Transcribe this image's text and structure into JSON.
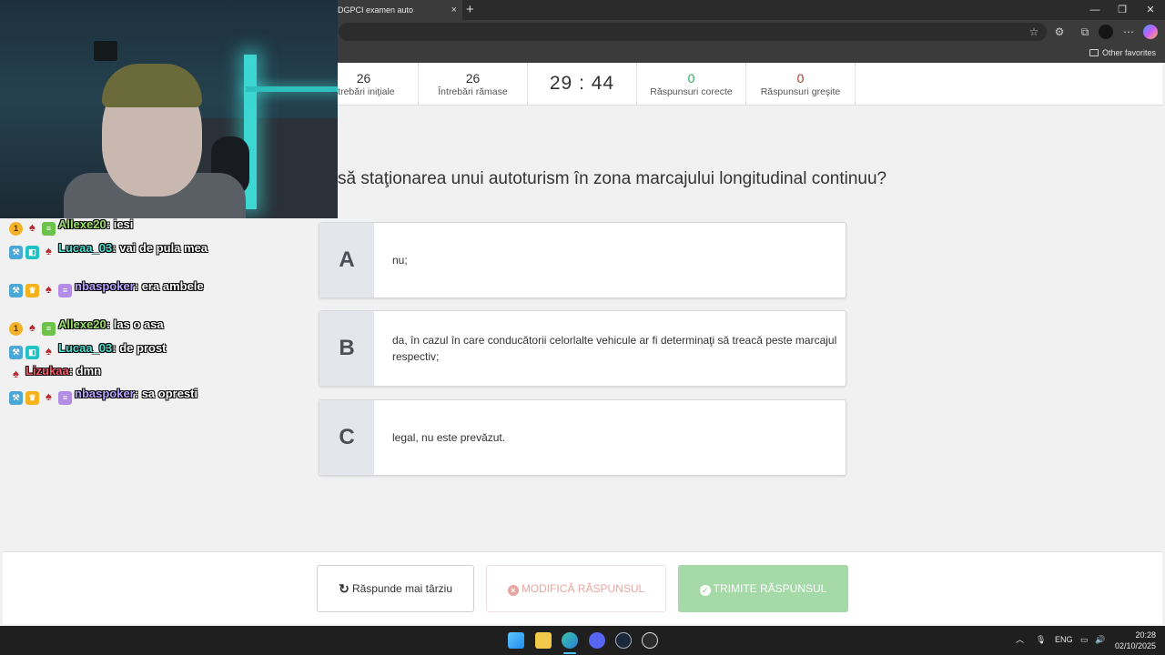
{
  "browser": {
    "tab_title": "DGPCI examen auto",
    "tab_close": "×",
    "new_tab": "+",
    "window_controls": {
      "minimize": "—",
      "maximize": "❐",
      "close": "✕"
    },
    "other_favorites": "Other favorites"
  },
  "stats": [
    {
      "value": "26",
      "label": "ntrebări iniţiale"
    },
    {
      "value": "26",
      "label": "Întrebări rămase"
    },
    {
      "value": "29 : 44",
      "label": ""
    },
    {
      "value": "0",
      "label": "Răspunsuri corecte"
    },
    {
      "value": "0",
      "label": "Răspunsuri greşite"
    }
  ],
  "question": {
    "text": "să staţionarea unui autoturism în zona marcajului longitudinal continuu?"
  },
  "answers": [
    {
      "letter": "A",
      "text": "nu;"
    },
    {
      "letter": "B",
      "text": "da, în cazul în care conducătorii celorlalte vehicule ar fi determinaţi să treacă peste marcajul respectiv;"
    },
    {
      "letter": "C",
      "text": "legal, nu este prevăzut."
    }
  ],
  "buttons": {
    "later": "Răspunde mai târziu",
    "modify": "MODIFICĂ RĂSPUNSUL",
    "send": "TRIMITE RĂSPUNSUL"
  },
  "chat": [
    {
      "user": "Allexe20",
      "message": "iesi"
    },
    {
      "user": "Lucaa_03",
      "message": "vai de pula mea"
    },
    {
      "user": "nbaspoker",
      "message": "era ambele"
    },
    {
      "user": "Allexe20",
      "message": "las o asa"
    },
    {
      "user": "Lucaa_03",
      "message": "de prost"
    },
    {
      "user": "Lizukaa",
      "message": "dmn"
    },
    {
      "user": "nbaspoker",
      "message": "sa opresti"
    }
  ],
  "taskbar": {
    "lang": "ENG",
    "time": "20:28",
    "date": "02/10/2025"
  },
  "colors": {
    "correct": "#27ae60",
    "wrong": "#b03a2e",
    "send_button": "#a5d9a8",
    "modify_button_text": "#e8a6a0",
    "answer_letter_bg": "#e3e6ea"
  }
}
